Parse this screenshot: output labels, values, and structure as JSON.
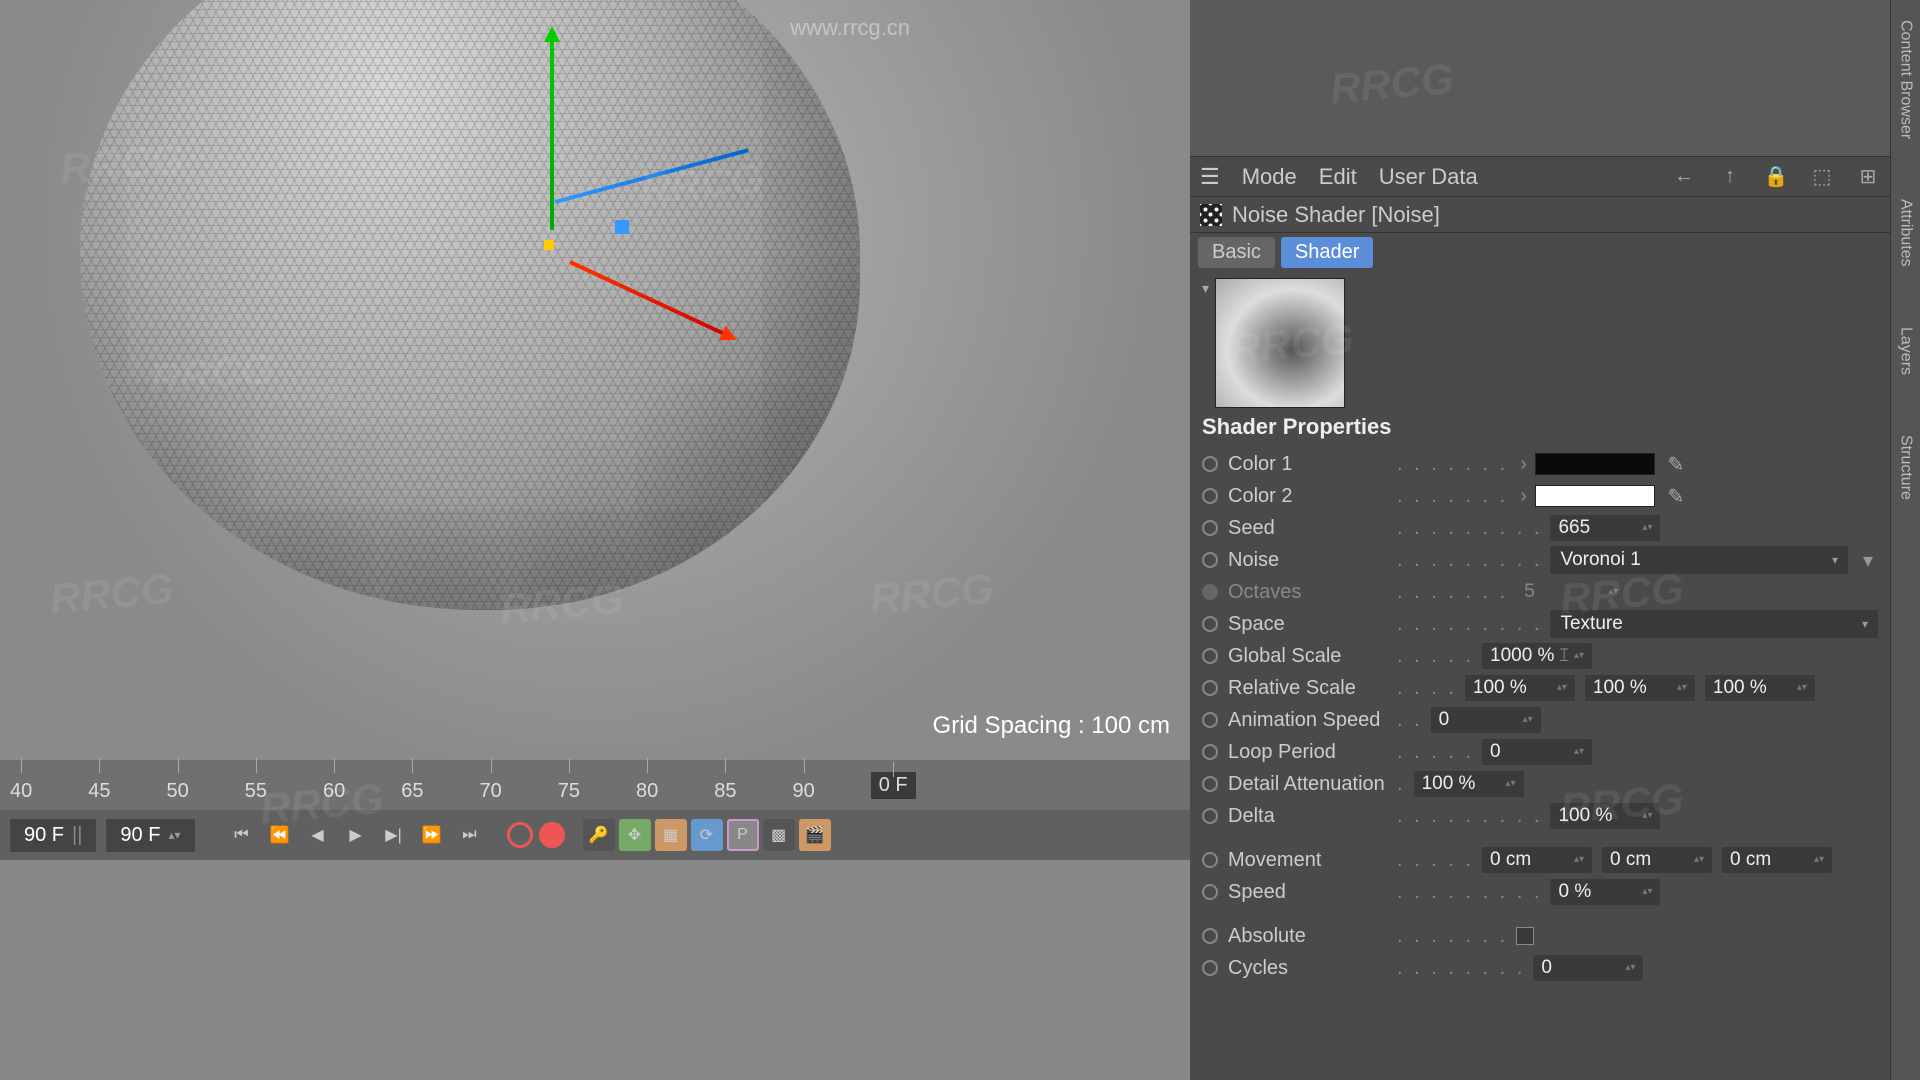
{
  "viewport": {
    "grid_spacing": "Grid Spacing : 100 cm",
    "url": "www.rrcg.cn"
  },
  "timeline": {
    "ticks": [
      "40",
      "45",
      "50",
      "55",
      "60",
      "65",
      "70",
      "75",
      "80",
      "85",
      "90"
    ],
    "end_label": "0 F"
  },
  "controls": {
    "cur_frame": "90 F",
    "total_frame": "90 F"
  },
  "side_tabs": {
    "content": "Content Browser",
    "attributes": "Attributes",
    "layers": "Layers",
    "structure": "Structure"
  },
  "attr_menu": {
    "mode": "Mode",
    "edit": "Edit",
    "user_data": "User Data"
  },
  "object": {
    "title": "Noise Shader [Noise]"
  },
  "tabs": {
    "basic": "Basic",
    "shader": "Shader"
  },
  "section": {
    "header": "Shader Properties"
  },
  "props": {
    "color1_label": "Color 1",
    "color1_value": "#0a0a0a",
    "color2_label": "Color 2",
    "color2_value": "#ffffff",
    "seed_label": "Seed",
    "seed_value": "665",
    "noise_label": "Noise",
    "noise_value": "Voronoi 1",
    "octaves_label": "Octaves",
    "octaves_value": "5",
    "space_label": "Space",
    "space_value": "Texture",
    "global_scale_label": "Global Scale",
    "global_scale_value": "1000 %",
    "rel_scale_label": "Relative Scale",
    "rel_scale_x": "100 %",
    "rel_scale_y": "100 %",
    "rel_scale_z": "100 %",
    "anim_speed_label": "Animation Speed",
    "anim_speed_value": "0",
    "loop_label": "Loop Period",
    "loop_value": "0",
    "detail_label": "Detail Attenuation",
    "detail_value": "100 %",
    "delta_label": "Delta",
    "delta_value": "100 %",
    "movement_label": "Movement",
    "movement_x": "0 cm",
    "movement_y": "0 cm",
    "movement_z": "0 cm",
    "speed_label": "Speed",
    "speed_value": "0 %",
    "absolute_label": "Absolute",
    "cycles_label": "Cycles",
    "cycles_value": "0"
  }
}
